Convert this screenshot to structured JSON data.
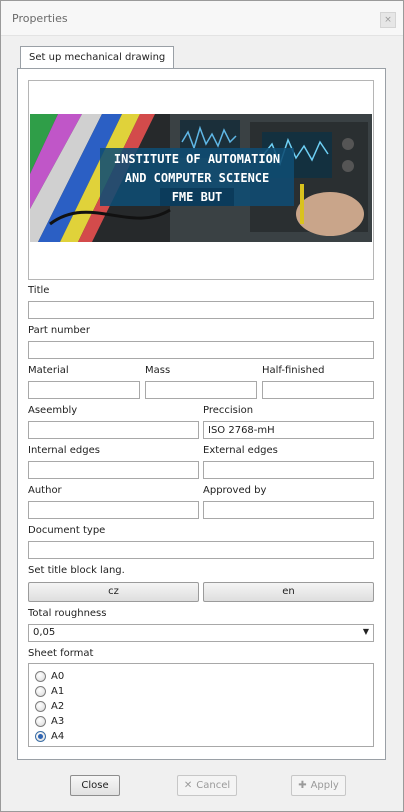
{
  "window": {
    "title": "Properties",
    "close_glyph": "×"
  },
  "tab": {
    "label": "Set up mechanical drawing"
  },
  "banner": {
    "line1": "INSTITUTE OF AUTOMATION",
    "line2": "AND COMPUTER SCIENCE",
    "line3": "FME BUT"
  },
  "fields": {
    "title": {
      "label": "Title",
      "value": ""
    },
    "part_number": {
      "label": "Part number",
      "value": ""
    },
    "material": {
      "label": "Material",
      "value": ""
    },
    "mass": {
      "label": "Mass",
      "value": ""
    },
    "half_finished": {
      "label": "Half-finished",
      "value": ""
    },
    "assembly": {
      "label": "Aseembly",
      "value": ""
    },
    "precision": {
      "label": "Preccision",
      "value": "ISO 2768-mH"
    },
    "internal_edges": {
      "label": "Internal edges",
      "value": ""
    },
    "external_edges": {
      "label": "External edges",
      "value": ""
    },
    "author": {
      "label": "Author",
      "value": ""
    },
    "approved_by": {
      "label": "Approved by",
      "value": ""
    },
    "document_type": {
      "label": "Document type",
      "value": ""
    }
  },
  "title_block_lang": {
    "label": "Set title block lang.",
    "cz": "cz",
    "en": "en"
  },
  "roughness": {
    "label": "Total roughness",
    "value": "0,05"
  },
  "sheet_format": {
    "label": "Sheet format",
    "options": [
      "A0",
      "A1",
      "A2",
      "A3",
      "A4"
    ],
    "selected": "A4"
  },
  "footer": {
    "close": "Close",
    "cancel": "Cancel",
    "apply": "Apply"
  },
  "colors": {
    "banner_box": "#0f4c73",
    "radio_checked": "#2d64b3"
  }
}
